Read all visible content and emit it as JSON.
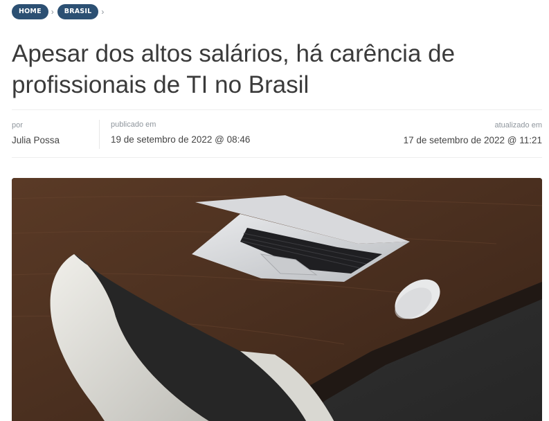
{
  "breadcrumb": {
    "items": [
      {
        "label": "HOME"
      },
      {
        "label": "BRASIL"
      }
    ],
    "separator": "›"
  },
  "article": {
    "title_line1": "Apesar dos altos salários, há carência de",
    "title_line2": "profissionais de TI no Brasil",
    "author_label": "por",
    "author_name": "Julia Possa",
    "published_label": "publicado em",
    "published_value": "19 de setembro de 2022 @ 08:46",
    "updated_label": "atualizado em",
    "updated_value": "17 de setembro de 2022 @ 11:21"
  },
  "colors": {
    "breadcrumb_bg": "#2c5073",
    "title": "#3a3a3a",
    "meta_label": "#8e959c"
  },
  "hero_image": {
    "subject": "laptop-on-wooden-desk-with-mouse-and-white-chair"
  }
}
